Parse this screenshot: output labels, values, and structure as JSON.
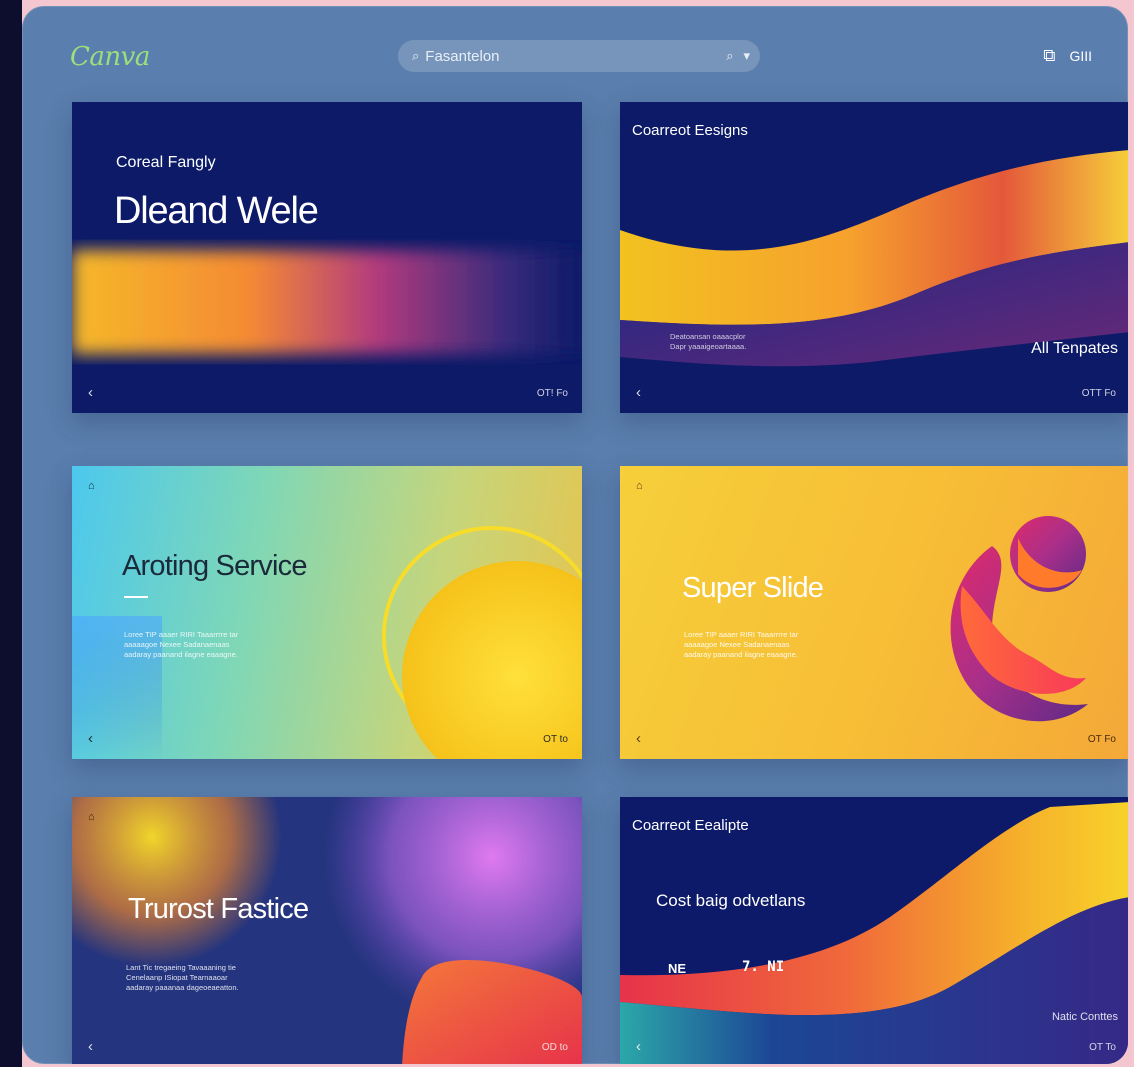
{
  "app": {
    "logo": "Canva"
  },
  "search": {
    "prefix_icon": "⌕",
    "value": "Fasantelon",
    "search_icon": "⌕",
    "dropdown_icon": "▾"
  },
  "header": {
    "share_icon": "⧉",
    "user_label": "GIII"
  },
  "cards": [
    {
      "subtitle": "Coreal Fangly",
      "title": "Dleand Wele",
      "nav": "‹",
      "page": "OT! Fo"
    },
    {
      "subtitle": "Coarreot Eesigns",
      "body": [
        "Deatoansan oaaacplor",
        "Dapr yaaaigeoartaaaa."
      ],
      "link": "All Tenpates",
      "nav": "‹",
      "page": "OTT Fo"
    },
    {
      "title": "Aroting Service",
      "body": [
        "Loree TIP aaaer RIRI Taaarrrre tar",
        "aaaaagoe Nexee Sadanaenaas",
        "aadaray paanand ilagne eaaagne."
      ],
      "nav": "‹",
      "page": "OT to",
      "lock": "⌂"
    },
    {
      "title": "Super Slide",
      "body": [
        "Loree TIP aaaer RIRI Taaarrrre tar",
        "aaaaagoe Nexee Sadanaenaas",
        "aadaray paanand ilagne eaaagne."
      ],
      "nav": "‹",
      "page": "OT Fo",
      "lock": "⌂"
    },
    {
      "title": "Trurost Fastice",
      "body": [
        "Lant Tic tregaeing Tavaaaning tie",
        "Cenelaanp ISiopat Tearnaaoar",
        "aadaray paaanaa dageoeaeatton."
      ],
      "nav": "‹",
      "page": "OD to",
      "lock": "⌂"
    },
    {
      "subtitle": "Coarreot Eealipte",
      "title": "Cost baig odvetlans",
      "extra_left": "NE",
      "extra_right": "7. NI",
      "link": "Natic Conttes",
      "nav": "‹",
      "page": "OT To"
    }
  ],
  "colors": {
    "background": "#5a7ead",
    "navy": "#0c1a68",
    "yellow": "#f6cf3a",
    "orange": "#f58a2a",
    "magenta": "#c53a86"
  }
}
